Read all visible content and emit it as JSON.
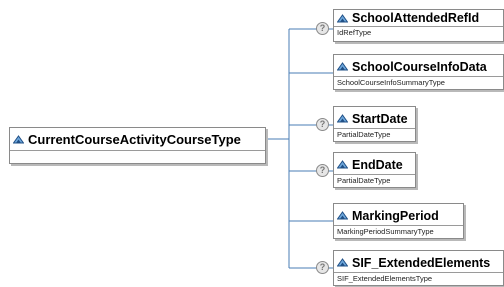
{
  "root": {
    "title": "CurrentCourseActivityCourseType",
    "subtitle": ""
  },
  "children": [
    {
      "title": "SchoolAttendedRefId",
      "type": "IdRefType",
      "optional": true
    },
    {
      "title": "SchoolCourseInfoData",
      "type": "SchoolCourseInfoSummaryType",
      "optional": false
    },
    {
      "title": "StartDate",
      "type": "PartialDateType",
      "optional": true
    },
    {
      "title": "EndDate",
      "type": "PartialDateType",
      "optional": true
    },
    {
      "title": "MarkingPeriod",
      "type": "MarkingPeriodSummaryType",
      "optional": false
    },
    {
      "title": "SIF_ExtendedElements",
      "type": "SIF_ExtendedElementsType",
      "optional": true
    }
  ],
  "optional_marker": "?",
  "colors": {
    "border": "#8a8a8a",
    "line": "#4a7db5",
    "icon_dark": "#1f4f86",
    "icon_light": "#6fa8dc"
  }
}
